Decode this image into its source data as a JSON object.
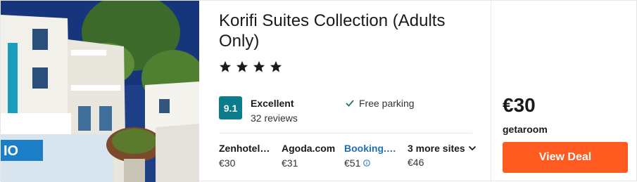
{
  "hotel": {
    "name": "Korifi Suites Collection (Adults Only)",
    "star_count": 4,
    "rating_score": "9.1",
    "rating_label": "Excellent",
    "rating_count": "32 reviews",
    "amenity": "Free parking"
  },
  "providers": [
    {
      "name": "Zenhotel…",
      "price": "€30",
      "link": false
    },
    {
      "name": "Agoda.com",
      "price": "€31",
      "link": false
    },
    {
      "name": "Booking.…",
      "price": "€51",
      "link": true
    }
  ],
  "more_sites": {
    "label": "3 more sites",
    "price": "€46"
  },
  "deal": {
    "price": "€30",
    "provider": "getaroom",
    "button": "View Deal"
  },
  "colors": {
    "accent": "#ff5a1f",
    "rating": "#0a7c8c",
    "link": "#1f6fb5"
  }
}
